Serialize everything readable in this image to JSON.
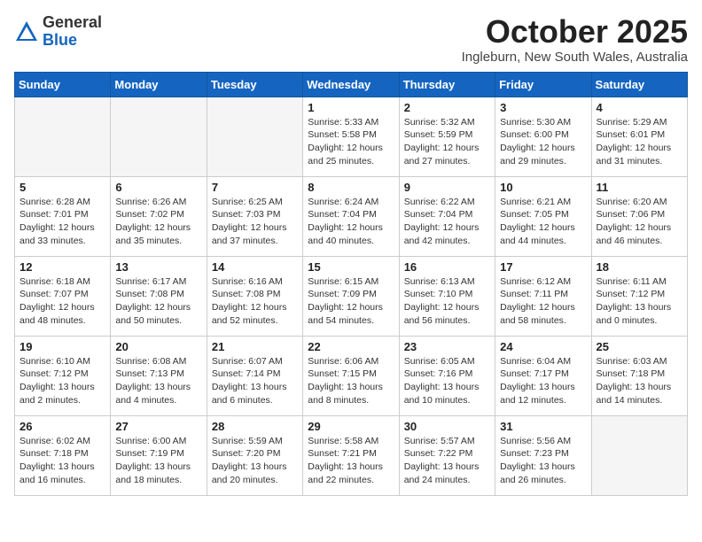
{
  "header": {
    "logo_general": "General",
    "logo_blue": "Blue",
    "month_title": "October 2025",
    "location": "Ingleburn, New South Wales, Australia"
  },
  "days_of_week": [
    "Sunday",
    "Monday",
    "Tuesday",
    "Wednesday",
    "Thursday",
    "Friday",
    "Saturday"
  ],
  "weeks": [
    [
      {
        "day": "",
        "info": ""
      },
      {
        "day": "",
        "info": ""
      },
      {
        "day": "",
        "info": ""
      },
      {
        "day": "1",
        "info": "Sunrise: 5:33 AM\nSunset: 5:58 PM\nDaylight: 12 hours\nand 25 minutes."
      },
      {
        "day": "2",
        "info": "Sunrise: 5:32 AM\nSunset: 5:59 PM\nDaylight: 12 hours\nand 27 minutes."
      },
      {
        "day": "3",
        "info": "Sunrise: 5:30 AM\nSunset: 6:00 PM\nDaylight: 12 hours\nand 29 minutes."
      },
      {
        "day": "4",
        "info": "Sunrise: 5:29 AM\nSunset: 6:01 PM\nDaylight: 12 hours\nand 31 minutes."
      }
    ],
    [
      {
        "day": "5",
        "info": "Sunrise: 6:28 AM\nSunset: 7:01 PM\nDaylight: 12 hours\nand 33 minutes."
      },
      {
        "day": "6",
        "info": "Sunrise: 6:26 AM\nSunset: 7:02 PM\nDaylight: 12 hours\nand 35 minutes."
      },
      {
        "day": "7",
        "info": "Sunrise: 6:25 AM\nSunset: 7:03 PM\nDaylight: 12 hours\nand 37 minutes."
      },
      {
        "day": "8",
        "info": "Sunrise: 6:24 AM\nSunset: 7:04 PM\nDaylight: 12 hours\nand 40 minutes."
      },
      {
        "day": "9",
        "info": "Sunrise: 6:22 AM\nSunset: 7:04 PM\nDaylight: 12 hours\nand 42 minutes."
      },
      {
        "day": "10",
        "info": "Sunrise: 6:21 AM\nSunset: 7:05 PM\nDaylight: 12 hours\nand 44 minutes."
      },
      {
        "day": "11",
        "info": "Sunrise: 6:20 AM\nSunset: 7:06 PM\nDaylight: 12 hours\nand 46 minutes."
      }
    ],
    [
      {
        "day": "12",
        "info": "Sunrise: 6:18 AM\nSunset: 7:07 PM\nDaylight: 12 hours\nand 48 minutes."
      },
      {
        "day": "13",
        "info": "Sunrise: 6:17 AM\nSunset: 7:08 PM\nDaylight: 12 hours\nand 50 minutes."
      },
      {
        "day": "14",
        "info": "Sunrise: 6:16 AM\nSunset: 7:08 PM\nDaylight: 12 hours\nand 52 minutes."
      },
      {
        "day": "15",
        "info": "Sunrise: 6:15 AM\nSunset: 7:09 PM\nDaylight: 12 hours\nand 54 minutes."
      },
      {
        "day": "16",
        "info": "Sunrise: 6:13 AM\nSunset: 7:10 PM\nDaylight: 12 hours\nand 56 minutes."
      },
      {
        "day": "17",
        "info": "Sunrise: 6:12 AM\nSunset: 7:11 PM\nDaylight: 12 hours\nand 58 minutes."
      },
      {
        "day": "18",
        "info": "Sunrise: 6:11 AM\nSunset: 7:12 PM\nDaylight: 13 hours\nand 0 minutes."
      }
    ],
    [
      {
        "day": "19",
        "info": "Sunrise: 6:10 AM\nSunset: 7:12 PM\nDaylight: 13 hours\nand 2 minutes."
      },
      {
        "day": "20",
        "info": "Sunrise: 6:08 AM\nSunset: 7:13 PM\nDaylight: 13 hours\nand 4 minutes."
      },
      {
        "day": "21",
        "info": "Sunrise: 6:07 AM\nSunset: 7:14 PM\nDaylight: 13 hours\nand 6 minutes."
      },
      {
        "day": "22",
        "info": "Sunrise: 6:06 AM\nSunset: 7:15 PM\nDaylight: 13 hours\nand 8 minutes."
      },
      {
        "day": "23",
        "info": "Sunrise: 6:05 AM\nSunset: 7:16 PM\nDaylight: 13 hours\nand 10 minutes."
      },
      {
        "day": "24",
        "info": "Sunrise: 6:04 AM\nSunset: 7:17 PM\nDaylight: 13 hours\nand 12 minutes."
      },
      {
        "day": "25",
        "info": "Sunrise: 6:03 AM\nSunset: 7:18 PM\nDaylight: 13 hours\nand 14 minutes."
      }
    ],
    [
      {
        "day": "26",
        "info": "Sunrise: 6:02 AM\nSunset: 7:18 PM\nDaylight: 13 hours\nand 16 minutes."
      },
      {
        "day": "27",
        "info": "Sunrise: 6:00 AM\nSunset: 7:19 PM\nDaylight: 13 hours\nand 18 minutes."
      },
      {
        "day": "28",
        "info": "Sunrise: 5:59 AM\nSunset: 7:20 PM\nDaylight: 13 hours\nand 20 minutes."
      },
      {
        "day": "29",
        "info": "Sunrise: 5:58 AM\nSunset: 7:21 PM\nDaylight: 13 hours\nand 22 minutes."
      },
      {
        "day": "30",
        "info": "Sunrise: 5:57 AM\nSunset: 7:22 PM\nDaylight: 13 hours\nand 24 minutes."
      },
      {
        "day": "31",
        "info": "Sunrise: 5:56 AM\nSunset: 7:23 PM\nDaylight: 13 hours\nand 26 minutes."
      },
      {
        "day": "",
        "info": ""
      }
    ]
  ]
}
